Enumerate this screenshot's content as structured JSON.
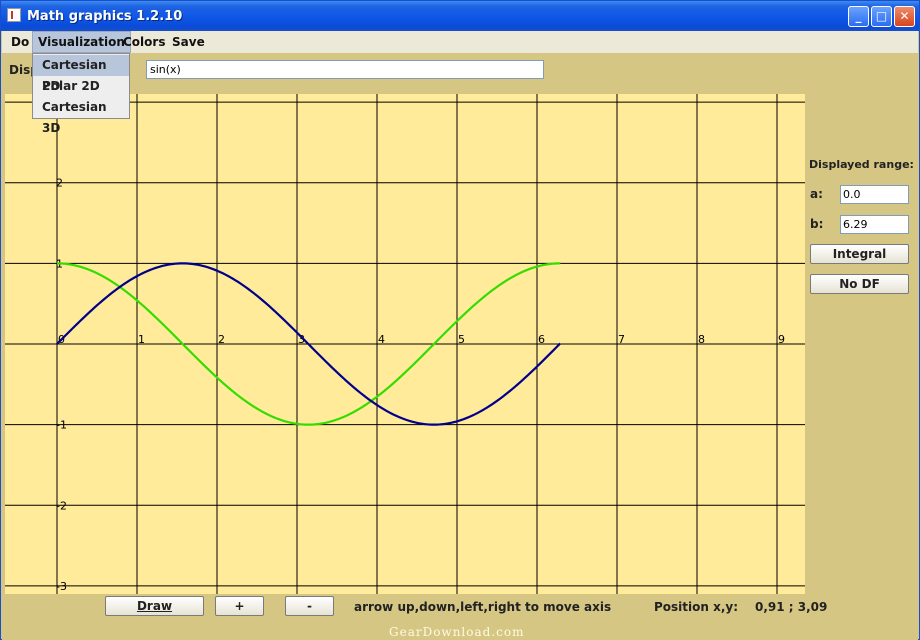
{
  "window": {
    "title": "Math graphics 1.2.10",
    "controls": {
      "minimize": "_",
      "maximize": "□",
      "close": "✕"
    }
  },
  "menubar": {
    "items": [
      "Do",
      "Visualization",
      "Colors",
      "Save"
    ],
    "open_menu": "Visualization",
    "dropdown": [
      "Cartesian 2D",
      "Polar 2D",
      "Cartesian 3D"
    ],
    "selected_item": "Cartesian 2D"
  },
  "function_panel": {
    "label": "Displayed function:",
    "visible_label": "Disp",
    "value": "sin(x)"
  },
  "range_panel": {
    "title": "Displayed range:",
    "a_label": "a:",
    "a_value": "0.0",
    "b_label": "b:",
    "b_value": "6.29",
    "integral_button": "Integral",
    "nodf_button": "No DF"
  },
  "bottom_bar": {
    "draw_button": "Draw",
    "plus_button": "+",
    "minus_button": "-",
    "hint": "arrow up,down,left,right to move axis",
    "position_label": "Position x,y:",
    "position_value": "0,91 ; 3,09"
  },
  "watermark": "GearDownload.com",
  "chart_data": {
    "type": "line",
    "x_ticks": [
      "0",
      "1",
      "2",
      "3",
      "4",
      "5",
      "6",
      "7",
      "8",
      "9"
    ],
    "y_ticks": [
      "2",
      "1",
      "-1",
      "-2",
      "-3"
    ],
    "xlim": [
      -0.65,
      9.35
    ],
    "ylim": [
      -3.1,
      3.1
    ],
    "grid": true,
    "colors": {
      "background": "#ffeb99",
      "grid": "#000000",
      "sin": "#00008b",
      "derivative": "#33dd00"
    },
    "series": [
      {
        "x_range": [
          0,
          6.29
        ],
        "function": "sin(x)"
      },
      {
        "x_range": [
          0,
          6.29
        ],
        "function": "cos(x)"
      }
    ]
  }
}
